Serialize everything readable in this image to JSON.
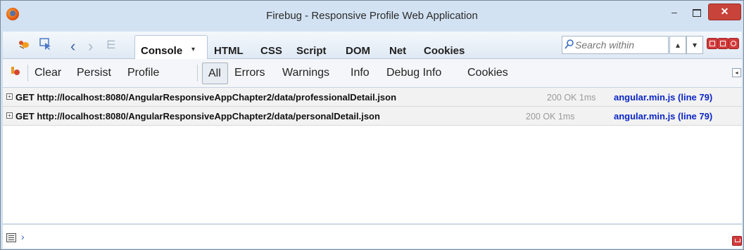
{
  "window": {
    "title": "Firebug - Responsive Profile Web Application",
    "minimize_label": "–",
    "close_label": "✕"
  },
  "toolbar": {
    "icons": {
      "firebug_menu": "firebug-icon",
      "inspect": "inspect-icon",
      "back": "‹",
      "forward": "›",
      "command_editor": "⋿"
    },
    "active_tab": "Console",
    "console_caret": "▾",
    "tabs": [
      "HTML",
      "CSS",
      "Script",
      "DOM",
      "Net",
      "Cookies"
    ],
    "search_placeholder": "Search within",
    "search_prev": "▴",
    "search_next": "▾"
  },
  "console_toolbar": {
    "items": [
      "Clear",
      "Persist",
      "Profile"
    ],
    "filters": [
      "All",
      "Errors",
      "Warnings",
      "Info",
      "Debug Info",
      "Cookies"
    ],
    "active_filter": "All"
  },
  "log_entries": [
    {
      "method_url": "GET http://localhost:8080/AngularResponsiveAppChapter2/data/professionalDetail.json",
      "status": "200 OK 1ms",
      "source": "angular.min.js (line 79)"
    },
    {
      "method_url": "GET http://localhost:8080/AngularResponsiveAppChapter2/data/personalDetail.json",
      "status": "200 OK 1ms",
      "source": "angular.min.js (line 79)"
    }
  ],
  "command_line": {
    "prompt": "›"
  }
}
